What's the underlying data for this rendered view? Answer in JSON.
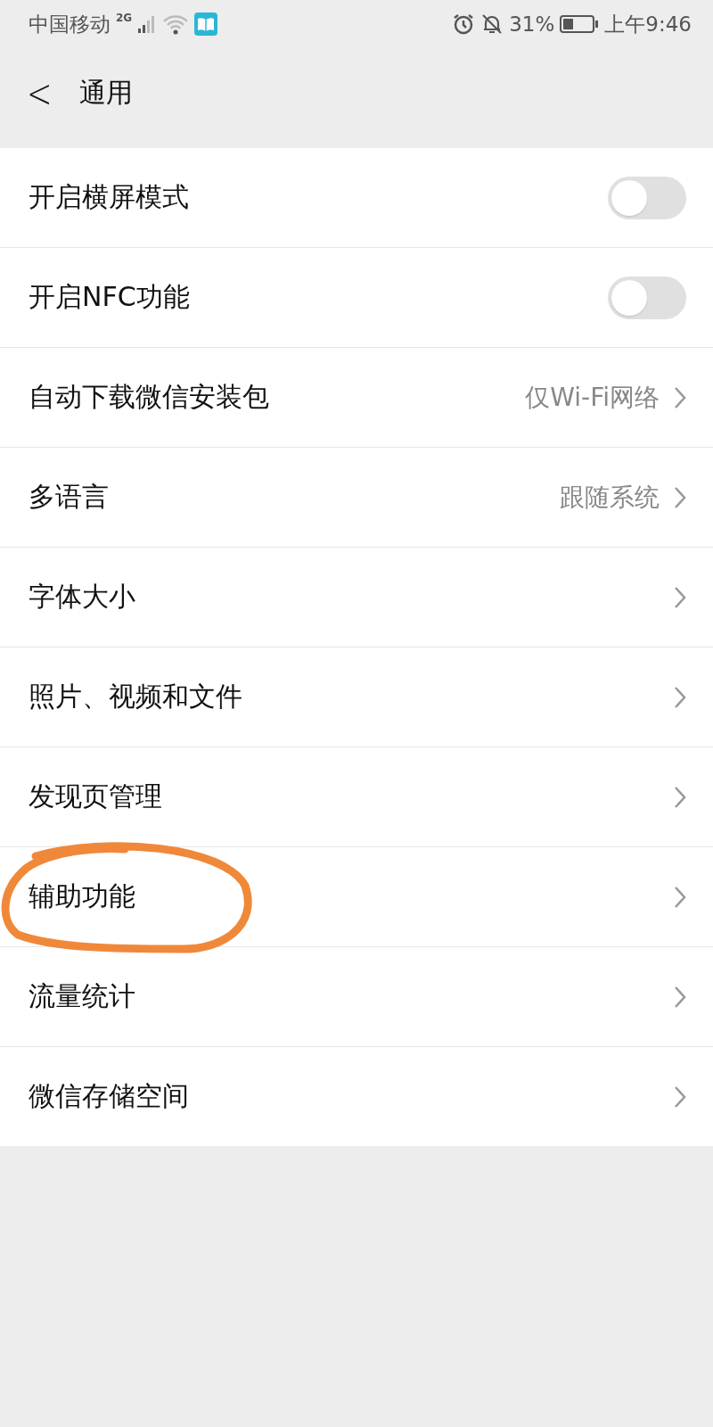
{
  "status_bar": {
    "carrier": "中国移动",
    "network": "2G",
    "battery": "31%",
    "time": "上午9:46"
  },
  "nav": {
    "back": "<",
    "title": "通用"
  },
  "items": [
    {
      "kind": "toggle",
      "label": "开启横屏模式",
      "on": false,
      "circled": false
    },
    {
      "kind": "toggle",
      "label": "开启NFC功能",
      "on": false,
      "circled": false
    },
    {
      "kind": "link",
      "label": "自动下载微信安装包",
      "value": "仅Wi-Fi网络",
      "circled": false
    },
    {
      "kind": "link",
      "label": "多语言",
      "value": "跟随系统",
      "circled": false
    },
    {
      "kind": "link",
      "label": "字体大小",
      "circled": false
    },
    {
      "kind": "link",
      "label": "照片、视频和文件",
      "circled": false
    },
    {
      "kind": "link",
      "label": "发现页管理",
      "circled": false
    },
    {
      "kind": "link",
      "label": "辅助功能",
      "circled": true
    },
    {
      "kind": "link",
      "label": "流量统计",
      "circled": false
    },
    {
      "kind": "link",
      "label": "微信存储空间",
      "circled": false
    }
  ]
}
